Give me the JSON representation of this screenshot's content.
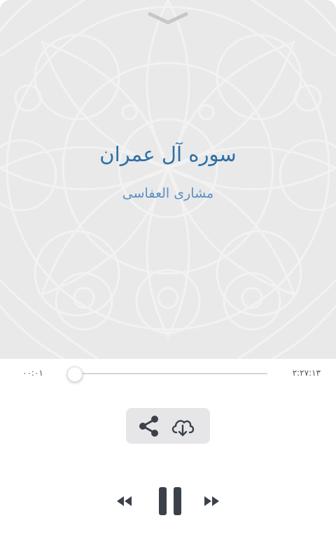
{
  "player": {
    "surah_title": "سوره آل عمران",
    "reciter_name": "مشاری العفاسی"
  },
  "playback": {
    "current_time": "۰۰:۰۱",
    "total_time": "۲:۲۷:۱۳",
    "progress_fraction": 0.001,
    "state": "playing"
  },
  "icons": {
    "collapse": "chevron-down-icon",
    "share": "share-icon",
    "download": "cloud-download-icon",
    "rewind": "rewind-icon",
    "pause": "pause-icon",
    "forward": "fast-forward-icon"
  },
  "colors": {
    "artwork_background": "#e9e9ea",
    "title": "#2e6fa4",
    "reciter": "#5b8fc0",
    "controls": "#3a414b",
    "action_box": "#e6e6e8"
  }
}
